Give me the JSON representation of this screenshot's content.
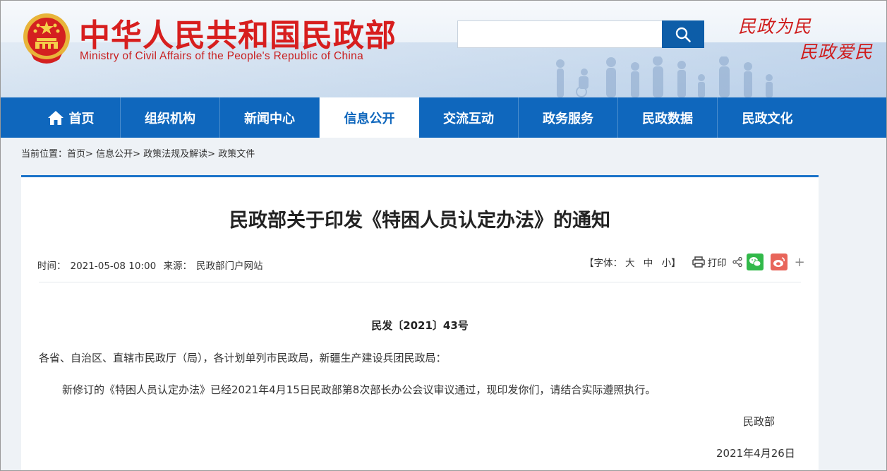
{
  "header": {
    "logo_cn": "中华人民共和国民政部",
    "logo_en": "Ministry of Civil Affairs of the People's Republic of China",
    "search_placeholder": "",
    "slogan_line1": "民政为民",
    "slogan_line2": "民政爱民"
  },
  "nav": {
    "items": [
      {
        "label": "首页"
      },
      {
        "label": "组织机构"
      },
      {
        "label": "新闻中心"
      },
      {
        "label": "信息公开"
      },
      {
        "label": "交流互动"
      },
      {
        "label": "政务服务"
      },
      {
        "label": "民政数据"
      },
      {
        "label": "民政文化"
      }
    ],
    "active_index": 3
  },
  "breadcrumb": {
    "prefix": "当前位置：",
    "items": [
      "首页",
      "信息公开",
      "政策法规及解读",
      "政策文件"
    ],
    "separator": ">"
  },
  "article": {
    "title": "民政部关于印发《特困人员认定办法》的通知",
    "time_label": "时间：",
    "time": "2021-05-08 10:00",
    "source_label": "来源：",
    "source": "民政部门户网站",
    "font_label": "【字体：",
    "font_large": "大",
    "font_medium": "中",
    "font_small": "小】",
    "print_label": "打印",
    "doc_number": "民发〔2021〕43号",
    "salutation": "各省、自治区、直辖市民政厅（局），各计划单列市民政局，新疆生产建设兵团民政局：",
    "body": "新修订的《特困人员认定办法》已经2021年4月15日民政部第8次部长办公会议审议通过，现印发你们，请结合实际遵照执行。",
    "signature": "民政部",
    "date": "2021年4月26日"
  },
  "colors": {
    "brand_red": "#d71e1e",
    "nav_blue": "#0f67bd",
    "search_blue": "#0d5da8",
    "wechat_green": "#32b94a",
    "weibo_red": "#e8655a"
  },
  "icons": {
    "search": "search-icon",
    "home": "home-icon",
    "print": "printer-icon",
    "share": "share-icon",
    "wechat": "wechat-icon",
    "weibo": "weibo-icon",
    "more": "plus-icon"
  }
}
